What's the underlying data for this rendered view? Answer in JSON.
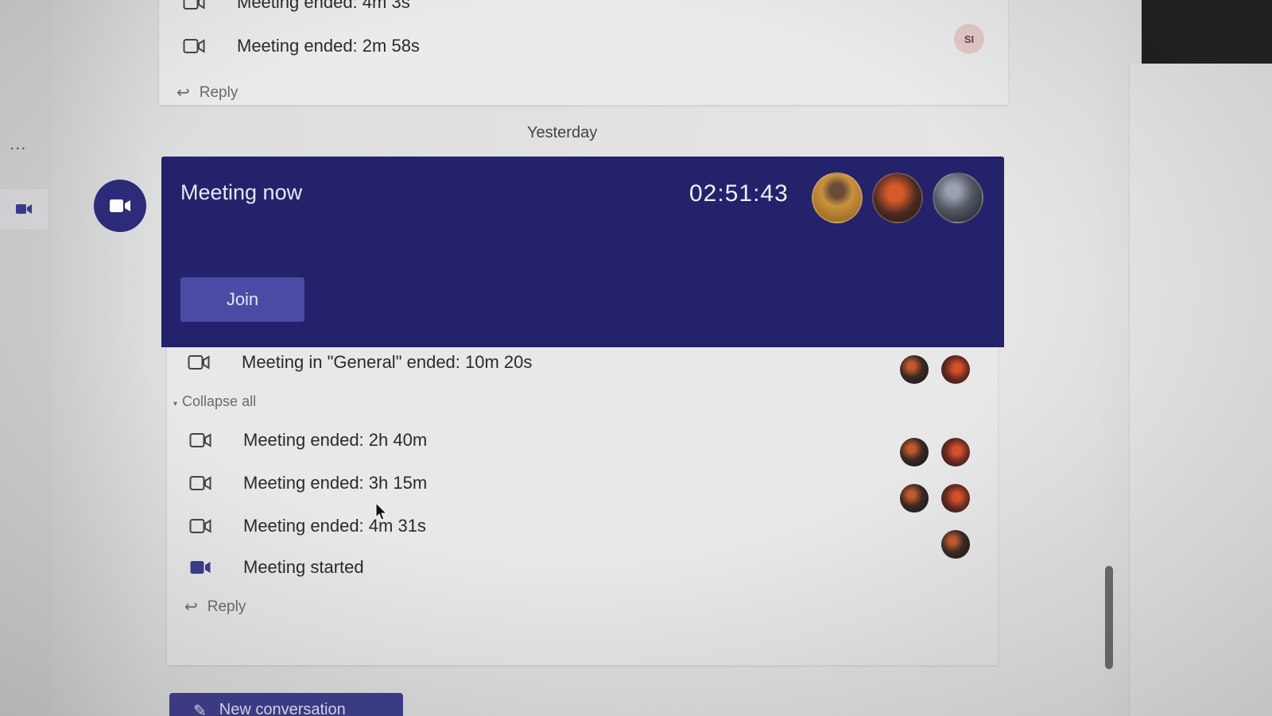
{
  "nav": {
    "more_label": "..."
  },
  "earlier_thread": {
    "rows": [
      {
        "text": "Meeting ended: 4m 3s"
      },
      {
        "text": "Meeting ended: 2m 58s",
        "avatar_initials": "SI"
      }
    ],
    "reply_label": "Reply"
  },
  "date_separator": "Yesterday",
  "meeting_banner": {
    "title": "Meeting now",
    "timer": "02:51:43",
    "join_label": "Join",
    "colors": {
      "banner": "#23226b",
      "join_button": "#4b4ba6"
    }
  },
  "thread": {
    "first_row": "Meeting in \"General\" ended: 10m 20s",
    "collapse_label": "Collapse all",
    "rows": [
      {
        "text": "Meeting ended: 2h 40m",
        "icon": "video-outline-icon"
      },
      {
        "text": "Meeting ended: 3h 15m",
        "icon": "video-outline-icon"
      },
      {
        "text": "Meeting ended: 4m 31s",
        "icon": "video-outline-icon"
      },
      {
        "text": "Meeting started",
        "icon": "video-filled-icon"
      }
    ],
    "reply_label": "Reply"
  },
  "new_conversation": {
    "label": "New conversation"
  }
}
